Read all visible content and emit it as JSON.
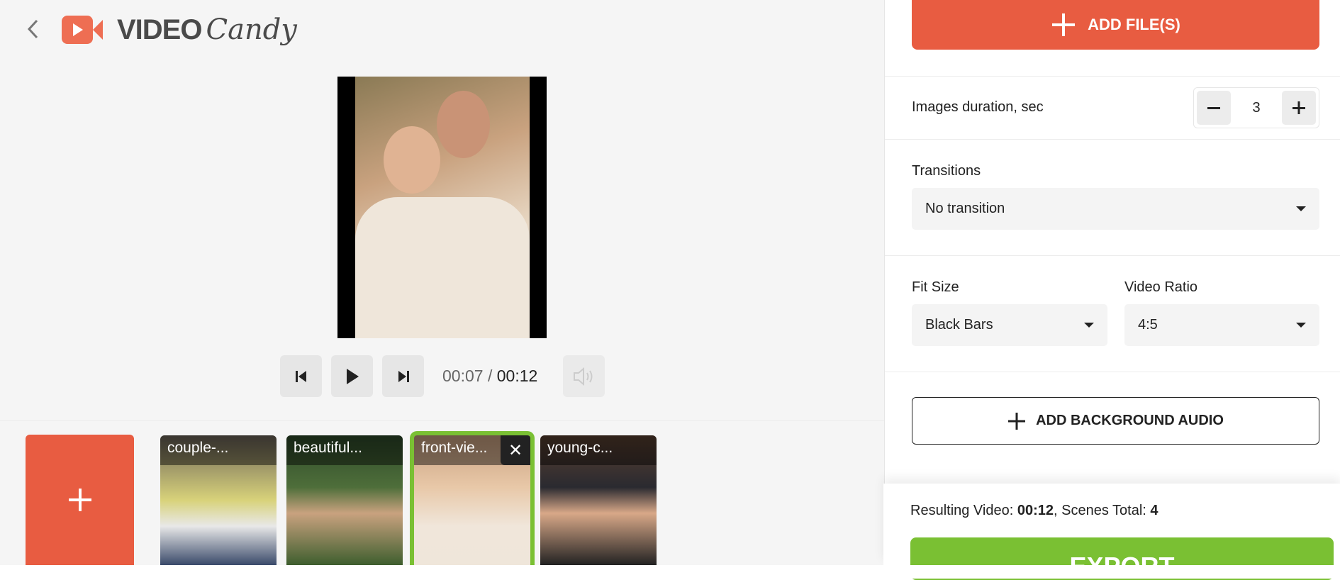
{
  "header": {
    "logo_text_bold": "VIDEO",
    "logo_text_script": "Candy"
  },
  "player": {
    "current_time": "00:07",
    "separator": " / ",
    "total_time": "00:12"
  },
  "timeline": {
    "thumbnails": [
      {
        "label": "couple-...",
        "selected": false
      },
      {
        "label": "beautiful...",
        "selected": false
      },
      {
        "label": "front-vie...",
        "selected": true
      },
      {
        "label": "young-c...",
        "selected": false
      }
    ],
    "remove_label": "✕"
  },
  "panel": {
    "add_files_label": "ADD FILE(S)",
    "duration_label": "Images duration, sec",
    "duration_value": "3",
    "transitions_label": "Transitions",
    "transitions_value": "No transition",
    "fit_size_label": "Fit Size",
    "fit_size_value": "Black Bars",
    "ratio_label": "Video Ratio",
    "ratio_value": "4:5",
    "add_audio_label": "ADD BACKGROUND AUDIO",
    "result_prefix": "Resulting Video: ",
    "result_duration": "00:12",
    "result_mid": ", Scenes Total: ",
    "result_scenes": "4",
    "export_label": "EXPORT"
  },
  "colors": {
    "accent": "#e85c41",
    "export": "#7ac033",
    "selected_border": "#7ac033"
  }
}
